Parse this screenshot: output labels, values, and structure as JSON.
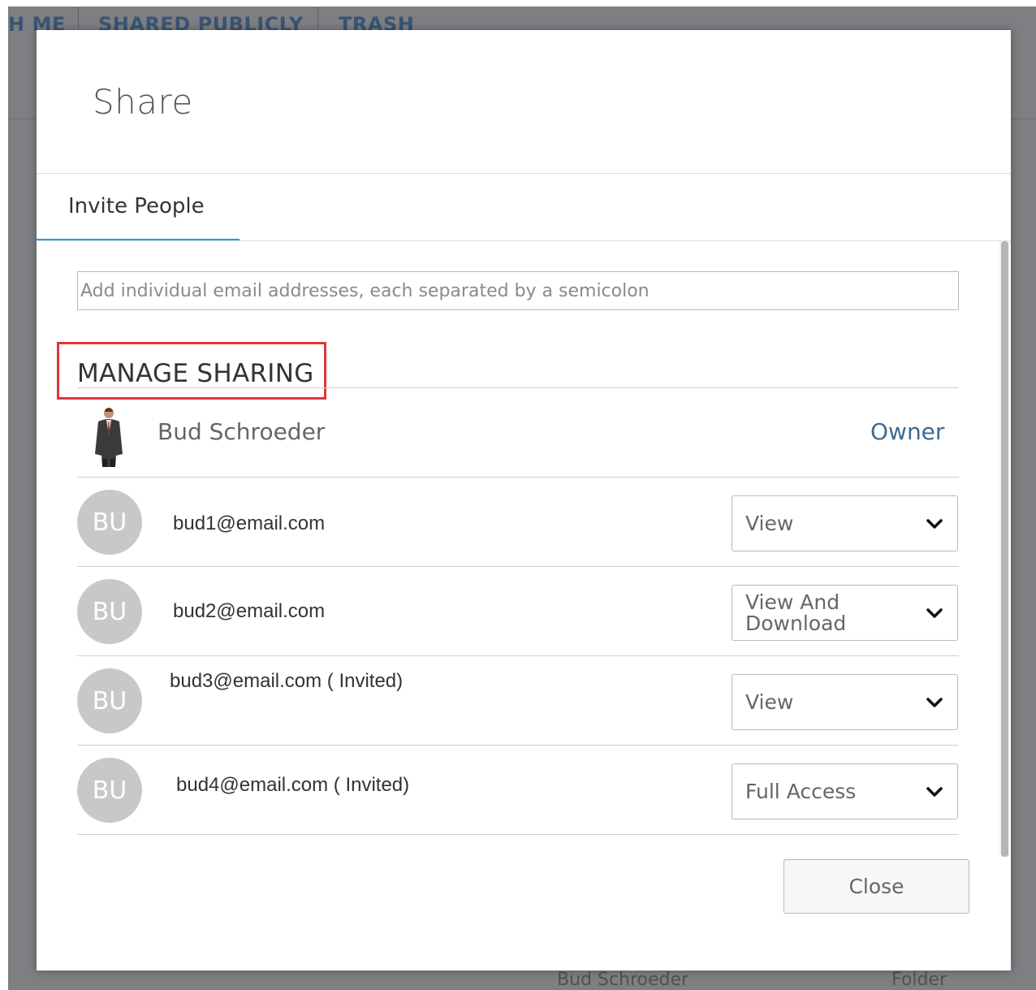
{
  "background": {
    "tabs": [
      "H ME",
      "SHARED PUBLICLY",
      "TRASH"
    ],
    "row": {
      "name": "Bud Schroeder",
      "type": "Folder"
    }
  },
  "dialog": {
    "title": "Share",
    "tab_label": "Invite People",
    "email_placeholder": "Add individual email addresses, each separated by a semicolon",
    "section_title": "MANAGE SHARING",
    "owner": {
      "name": "Bud Schroeder",
      "role": "Owner"
    },
    "users": [
      {
        "initials": "BU",
        "email": "bud1@email.com",
        "permission": "View"
      },
      {
        "initials": "BU",
        "email": "bud2@email.com",
        "permission": "View And Download"
      },
      {
        "initials": "BU",
        "email": "bud3@email.com ( Invited)",
        "permission": "View"
      },
      {
        "initials": "BU",
        "email": "bud4@email.com ( Invited)",
        "permission": "Full Access"
      }
    ],
    "close_label": "Close"
  },
  "colors": {
    "accent_tab_underline": "#1ba1e2",
    "owner_role": "#3d6b93",
    "highlight_box": "#e2353b",
    "avatar_bg": "#c8c8c8",
    "backdrop": "#7d7f82"
  },
  "icons": {
    "dropdown": "chevron-down-icon",
    "owner_photo": "user-photo"
  }
}
